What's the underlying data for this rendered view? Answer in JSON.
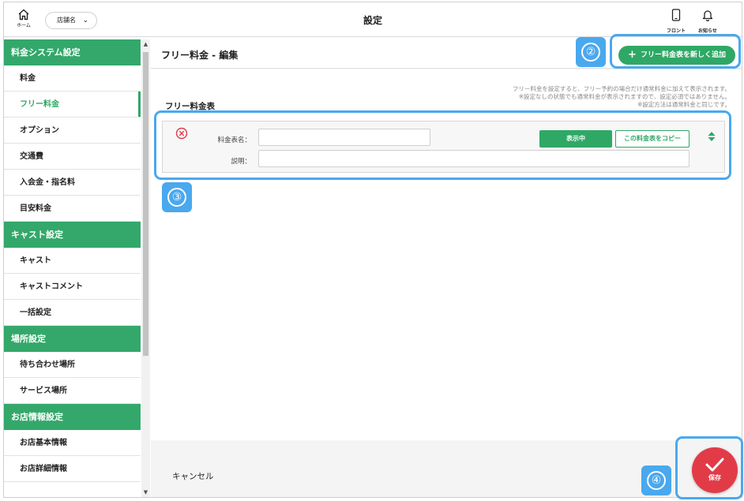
{
  "topbar": {
    "home_label": "ホーム",
    "store_select_value": "店舗名",
    "page_title": "設定",
    "front_label": "フロント",
    "notice_label": "お知らせ"
  },
  "sidebar": {
    "sections": [
      {
        "title": "料金システム設定",
        "items": [
          "料金",
          "フリー料金",
          "オプション",
          "交通費",
          "入会金・指名料",
          "目安料金"
        ]
      },
      {
        "title": "キャスト設定",
        "items": [
          "キャスト",
          "キャストコメント",
          "一括設定"
        ]
      },
      {
        "title": "場所設定",
        "items": [
          "待ち合わせ場所",
          "サービス場所"
        ]
      },
      {
        "title": "お店情報設定",
        "items": [
          "お店基本情報",
          "お店詳細情報"
        ]
      }
    ],
    "active_item": "フリー料金"
  },
  "main": {
    "title": "フリー料金 - 編集",
    "add_button": "フリー料金表を新しく追加",
    "section_title": "フリー料金表",
    "note_lines": [
      "フリー料金を設定すると、フリー予約の場合だけ通常料金に加えて表示されます。",
      "※設定なしの状態でも通常料金が表示されますので、設定必須ではありません。",
      "※設定方法は通常料金と同じです。"
    ],
    "table": {
      "name_label": "料金表名：",
      "name_value": "",
      "desc_label": "説明：",
      "desc_value": "",
      "visible_button": "表示中",
      "copy_button": "この料金表をコピー"
    },
    "cancel_label": "キャンセル",
    "save_label": "保存"
  },
  "annotations": {
    "badge_2": "②",
    "badge_3": "③",
    "badge_4": "④"
  },
  "colors": {
    "brand_green": "#2fa866",
    "header_green": "#33a86a",
    "save_red": "#e23b48",
    "annotation_blue": "#4aa8ee"
  }
}
